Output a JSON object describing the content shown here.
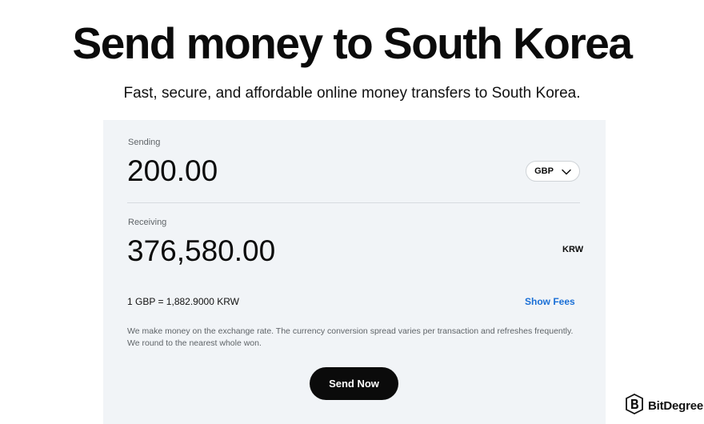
{
  "header": {
    "title": "Send money to South Korea",
    "subtitle": "Fast, secure, and affordable online money transfers to South Korea."
  },
  "converter": {
    "sending_label": "Sending",
    "sending_amount": "200.00",
    "sending_currency": "GBP",
    "receiving_label": "Receiving",
    "receiving_amount": "376,580.00",
    "receiving_currency": "KRW",
    "rate_text": "1 GBP = 1,882.9000 KRW",
    "show_fees_label": "Show Fees",
    "disclaimer_line1": "We make money on the exchange rate. The currency conversion spread varies per transaction and refreshes frequently.",
    "disclaimer_line2": "We round to the nearest whole won.",
    "send_button_label": "Send Now"
  },
  "watermark": {
    "text": "BitDegree",
    "icon": "bitdegree-logo-icon"
  },
  "colors": {
    "card_background": "#f1f4f7",
    "link": "#1a6fd6",
    "button": "#0b0b0b"
  }
}
